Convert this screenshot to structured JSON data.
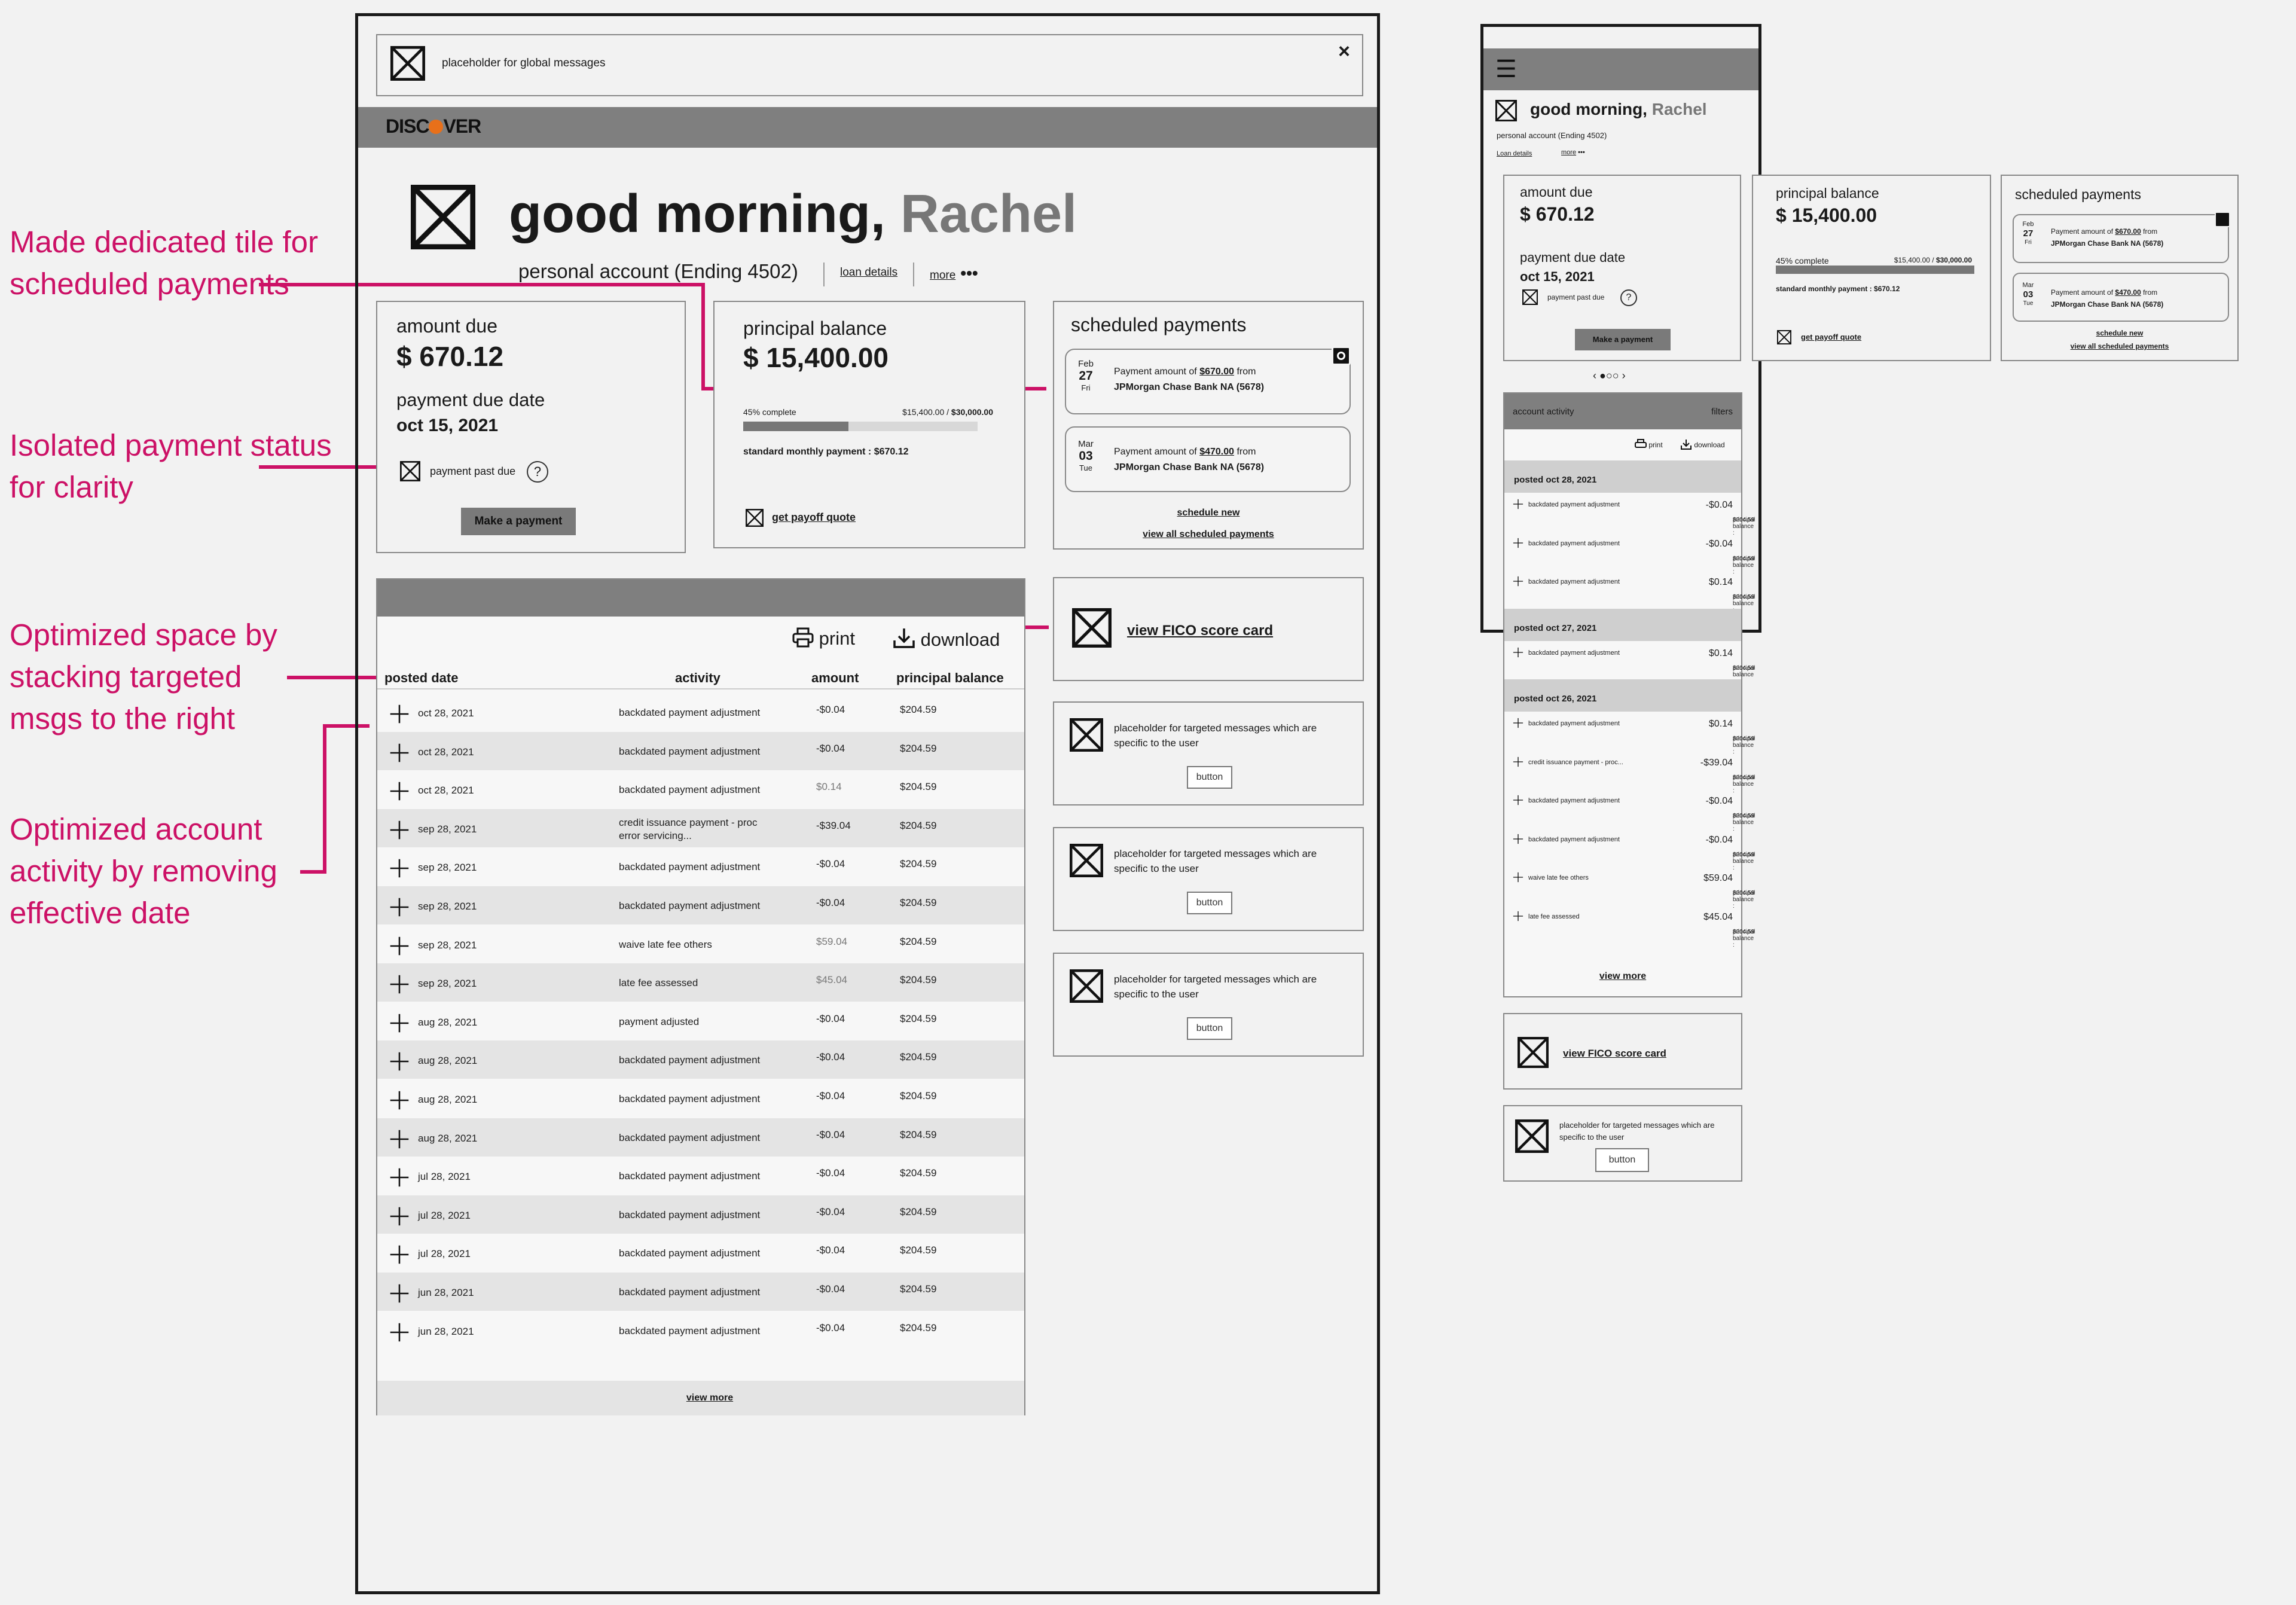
{
  "annotations": [
    "Made dedicated tile for scheduled payments",
    "Isolated payment status for clarity",
    "Optimized space by stacking targeted msgs to the right",
    "Optimized account activity by removing effective date"
  ],
  "global_message": "placeholder for global messages",
  "close_symbol": "×",
  "brand": "DISC",
  "brand_tail": "VER",
  "greeting": "good morning, ",
  "user_name": "Rachel",
  "account_label": "personal account (Ending 4502)",
  "loan_details": "loan details",
  "more": "more",
  "amount_due": {
    "label": "amount due",
    "value": "$ 670.12",
    "due_label": "payment due date",
    "due_date": "oct 15, 2021",
    "status": "payment past due",
    "help": "?",
    "button": "Make a payment"
  },
  "principal": {
    "label": "principal balance",
    "value": "$ 15,400.00",
    "progress_text": "45% complete",
    "progress_fraction": 0.45,
    "progress_prefix": "$15,400.00 / ",
    "progress_total": "$30,000.00",
    "monthly": "standard monthly payment : $670.12",
    "payoff": "get payoff quote"
  },
  "scheduled": {
    "title": "scheduled payments",
    "items": [
      {
        "month": "Feb",
        "day": "27",
        "dow": "Fri",
        "pre": "Payment amount of ",
        "amount": "$670.00",
        "post": " from",
        "bank": "JPMorgan Chase Bank NA (5678)"
      },
      {
        "month": "Mar",
        "day": "03",
        "dow": "Tue",
        "pre": "Payment amount of ",
        "amount": "$470.00",
        "post": " from",
        "bank": "JPMorgan Chase Bank NA (5678)"
      }
    ],
    "schedule_new": "schedule new",
    "view_all": "view all scheduled payments"
  },
  "fico": "view FICO score card",
  "targeted": {
    "text": "placeholder for targeted messages which are specific to the user",
    "button": "button"
  },
  "activity": {
    "print": "print",
    "download": "download",
    "columns": [
      "posted date",
      "activity",
      "amount",
      "principal balance"
    ],
    "rows": [
      {
        "date": "oct 28, 2021",
        "activity": "backdated payment adjustment",
        "amount": "-$0.04",
        "balance": "$204.59"
      },
      {
        "date": "oct 28, 2021",
        "activity": "backdated payment adjustment",
        "amount": "-$0.04",
        "balance": "$204.59"
      },
      {
        "date": "oct 28, 2021",
        "activity": "backdated payment adjustment",
        "amount": "$0.14",
        "balance": "$204.59"
      },
      {
        "date": "sep 28, 2021",
        "activity": "credit issuance payment - proc error servicing...",
        "amount": "-$39.04",
        "balance": "$204.59"
      },
      {
        "date": "sep 28, 2021",
        "activity": "backdated payment adjustment",
        "amount": "-$0.04",
        "balance": "$204.59"
      },
      {
        "date": "sep 28, 2021",
        "activity": "backdated payment adjustment",
        "amount": "-$0.04",
        "balance": "$204.59"
      },
      {
        "date": "sep 28, 2021",
        "activity": "waive late fee others",
        "amount": "$59.04",
        "balance": "$204.59"
      },
      {
        "date": "sep 28, 2021",
        "activity": "late fee assessed",
        "amount": "$45.04",
        "balance": "$204.59"
      },
      {
        "date": "aug 28, 2021",
        "activity": "payment adjusted",
        "amount": "-$0.04",
        "balance": "$204.59"
      },
      {
        "date": "aug 28, 2021",
        "activity": "backdated payment adjustment",
        "amount": "-$0.04",
        "balance": "$204.59"
      },
      {
        "date": "aug 28, 2021",
        "activity": "backdated payment adjustment",
        "amount": "-$0.04",
        "balance": "$204.59"
      },
      {
        "date": "aug 28, 2021",
        "activity": "backdated payment adjustment",
        "amount": "-$0.04",
        "balance": "$204.59"
      },
      {
        "date": "jul 28, 2021",
        "activity": "backdated payment adjustment",
        "amount": "-$0.04",
        "balance": "$204.59"
      },
      {
        "date": "jul 28, 2021",
        "activity": "backdated payment adjustment",
        "amount": "-$0.04",
        "balance": "$204.59"
      },
      {
        "date": "jul 28, 2021",
        "activity": "backdated payment adjustment",
        "amount": "-$0.04",
        "balance": "$204.59"
      },
      {
        "date": "jun 28, 2021",
        "activity": "backdated payment adjustment",
        "amount": "-$0.04",
        "balance": "$204.59"
      },
      {
        "date": "jun 28, 2021",
        "activity": "backdated payment adjustment",
        "amount": "-$0.04",
        "balance": "$204.59"
      }
    ],
    "view_more": "view more"
  },
  "mobile": {
    "menu": "☰",
    "account_label": "personal account (Ending 4502)",
    "loan_details": "Loan details",
    "more": "more",
    "activity_title": "account activity",
    "filters": "filters",
    "print": "print",
    "download": "download",
    "balance_prefix": "principal balance : ",
    "groups": [
      {
        "header": "posted oct 28, 2021",
        "rows": [
          {
            "activity": "backdated payment adjustment",
            "amount": "-$0.04",
            "balance": "$204.59"
          },
          {
            "activity": "backdated payment adjustment",
            "amount": "-$0.04",
            "balance": "$204.59"
          },
          {
            "activity": "backdated payment adjustment",
            "amount": "$0.14",
            "balance": "$204.59"
          }
        ]
      },
      {
        "header": "posted oct 27, 2021",
        "rows": [
          {
            "activity": "backdated payment adjustment",
            "amount": "$0.14",
            "balance": "$204.59"
          }
        ]
      },
      {
        "header": "posted oct 26, 2021",
        "rows": [
          {
            "activity": "backdated payment adjustment",
            "amount": "$0.14",
            "balance": "$204.59"
          },
          {
            "activity": "credit issuance payment - proc...",
            "amount": "-$39.04",
            "balance": "$204.59"
          },
          {
            "activity": "backdated payment adjustment",
            "amount": "-$0.04",
            "balance": "$204.59"
          },
          {
            "activity": "backdated payment adjustment",
            "amount": "-$0.04",
            "balance": "$204.59"
          },
          {
            "activity": "waive late fee others",
            "amount": "$59.04",
            "balance": "$204.59"
          },
          {
            "activity": "late fee assessed",
            "amount": "$45.04",
            "balance": "$204.59"
          }
        ]
      }
    ],
    "view_more": "view more"
  },
  "colors": {
    "accent": "#cc1166",
    "header_gray": "#7f7f7f",
    "background": "#f2f2f2"
  }
}
